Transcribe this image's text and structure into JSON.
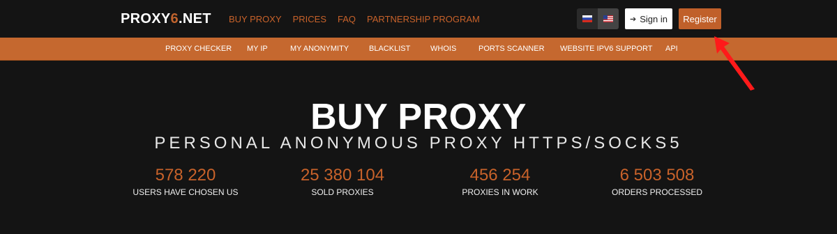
{
  "logo": {
    "text": "PROXY",
    "accent": "6",
    "suffix": ".NET"
  },
  "main_nav": [
    {
      "label": "BUY PROXY"
    },
    {
      "label": "PRICES"
    },
    {
      "label": "FAQ"
    },
    {
      "label": "PARTNERSHIP PROGRAM"
    }
  ],
  "languages": [
    {
      "name": "ru-flag-icon"
    },
    {
      "name": "us-flag-icon",
      "active": true
    }
  ],
  "auth": {
    "signin_label": "Sign in",
    "register_label": "Register"
  },
  "sub_nav": [
    {
      "label": "PROXY CHECKER"
    },
    {
      "label": "MY IP"
    },
    {
      "label": "MY ANONYMITY"
    },
    {
      "label": "BLACKLIST"
    },
    {
      "label": "WHOIS"
    },
    {
      "label": "PORTS SCANNER"
    },
    {
      "label": "WEBSITE IPV6 SUPPORT"
    },
    {
      "label": "API"
    }
  ],
  "hero": {
    "title": "BUY PROXY",
    "subtitle": "PERSONAL ANONYMOUS PROXY HTTPS/SOCKS5"
  },
  "stats": [
    {
      "value": "578 220",
      "label": "USERS HAVE CHOSEN US"
    },
    {
      "value": "25 380 104",
      "label": "SOLD PROXIES"
    },
    {
      "value": "456 254",
      "label": "PROXIES IN WORK"
    },
    {
      "value": "6 503 508",
      "label": "ORDERS PROCESSED"
    }
  ],
  "colors": {
    "accent": "#c5682f",
    "background": "#141414",
    "annotation_arrow": "#ff1a1a"
  }
}
